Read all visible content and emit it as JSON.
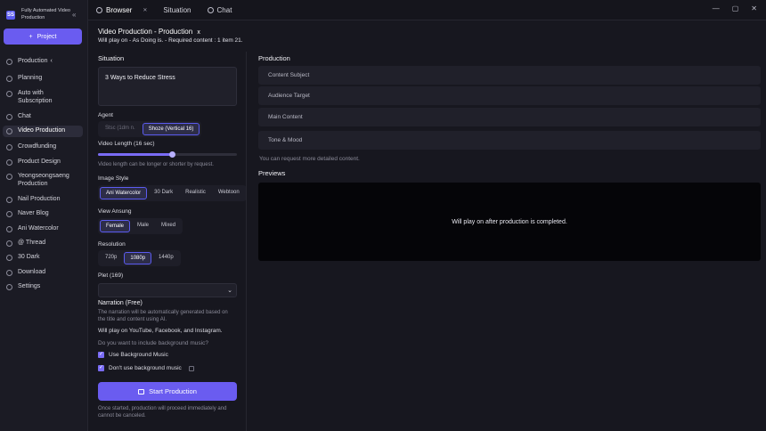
{
  "brand": {
    "logo_text": "SS",
    "name": "Fully Automated Video Production"
  },
  "sidebar": {
    "project_button": "Project",
    "items": [
      {
        "label": "Production",
        "suffix": "‹",
        "icon": "production-icon"
      },
      {
        "label": "Planning",
        "icon": "planning-icon"
      },
      {
        "label": "Auto with Subscription",
        "icon": "auto-icon"
      },
      {
        "label": "Chat",
        "icon": "chat-icon"
      },
      {
        "label": "Video Production",
        "icon": "video-icon",
        "active": true
      },
      {
        "label": "Crowdfunding",
        "icon": "crowdfunding-icon"
      },
      {
        "label": "Product Design",
        "icon": "design-icon"
      },
      {
        "label": "Yeongseongsaeng Production",
        "icon": "yeong-icon"
      },
      {
        "label": "Nail Production",
        "icon": "nail-icon"
      },
      {
        "label": "Naver Blog",
        "icon": "blog-icon"
      },
      {
        "label": "Ani Watercolor",
        "icon": "watercolor-icon"
      },
      {
        "label": "@ Thread",
        "icon": "thread-icon"
      },
      {
        "label": "30 Dark",
        "icon": "dark-icon"
      },
      {
        "label": "Download",
        "icon": "download-icon"
      },
      {
        "label": "Settings",
        "icon": "settings-icon"
      }
    ]
  },
  "tabs": [
    {
      "label": "Browser",
      "active": true,
      "closable": true
    },
    {
      "label": "Situation"
    },
    {
      "label": "Chat"
    }
  ],
  "window_controls": [
    "—",
    "▢",
    "✕"
  ],
  "header": {
    "title": "Video Production - Production",
    "title_close": "x",
    "subtitle": "Will play on - As Doing is. - Required content : 1 item 21."
  },
  "situation": {
    "heading": "Situation",
    "topic": "3 Ways to Reduce Stress",
    "agent_label": "Agent",
    "agent_options": [
      "Stsc (1dm n.",
      "Shoze (Vertical 16)"
    ],
    "agent_selected": 1,
    "length_label": "Video Length (16 sec)",
    "length_fraction": 0.53,
    "length_hint": "Video length can be longer or shorter by request.",
    "style_label": "Image Style",
    "style_options": [
      "Ani Watercolor",
      "30 Dark",
      "Realistic",
      "Webtoon"
    ],
    "style_selected": 0,
    "voice_label": "View Ansung",
    "voice_options": [
      "Female",
      "Male",
      "Mixed"
    ],
    "voice_selected": 0,
    "resolution_label": "Resolution",
    "resolution_options": [
      "720p",
      "1080p",
      "1440p"
    ],
    "resolution_selected": 1,
    "plot_label": "Plet (169)",
    "narration_label": "Narration (Free)",
    "narration_hint": "The narration will be automatically generated based on the title and content using AI.",
    "platforms": "Will play on YouTube, Facebook, and Instagram.",
    "music_question": "Do you want to include background music?",
    "music_yes": "Use Background Music",
    "music_no": "Don't use background music",
    "start_button": "Start Production",
    "start_hint": "Once started, production will proceed immediately and cannot be canceled."
  },
  "production": {
    "heading": "Production",
    "fields": [
      "Content Subject",
      "Audience Target",
      "Main Content",
      "Tone & Mood"
    ],
    "fields_hint": "You can request more detailed content.",
    "previews_heading": "Previews",
    "preview_message": "Will play on after production is completed."
  },
  "colors": {
    "accent": "#6a5cf0",
    "background": "#17171f",
    "panel": "#20202a"
  }
}
